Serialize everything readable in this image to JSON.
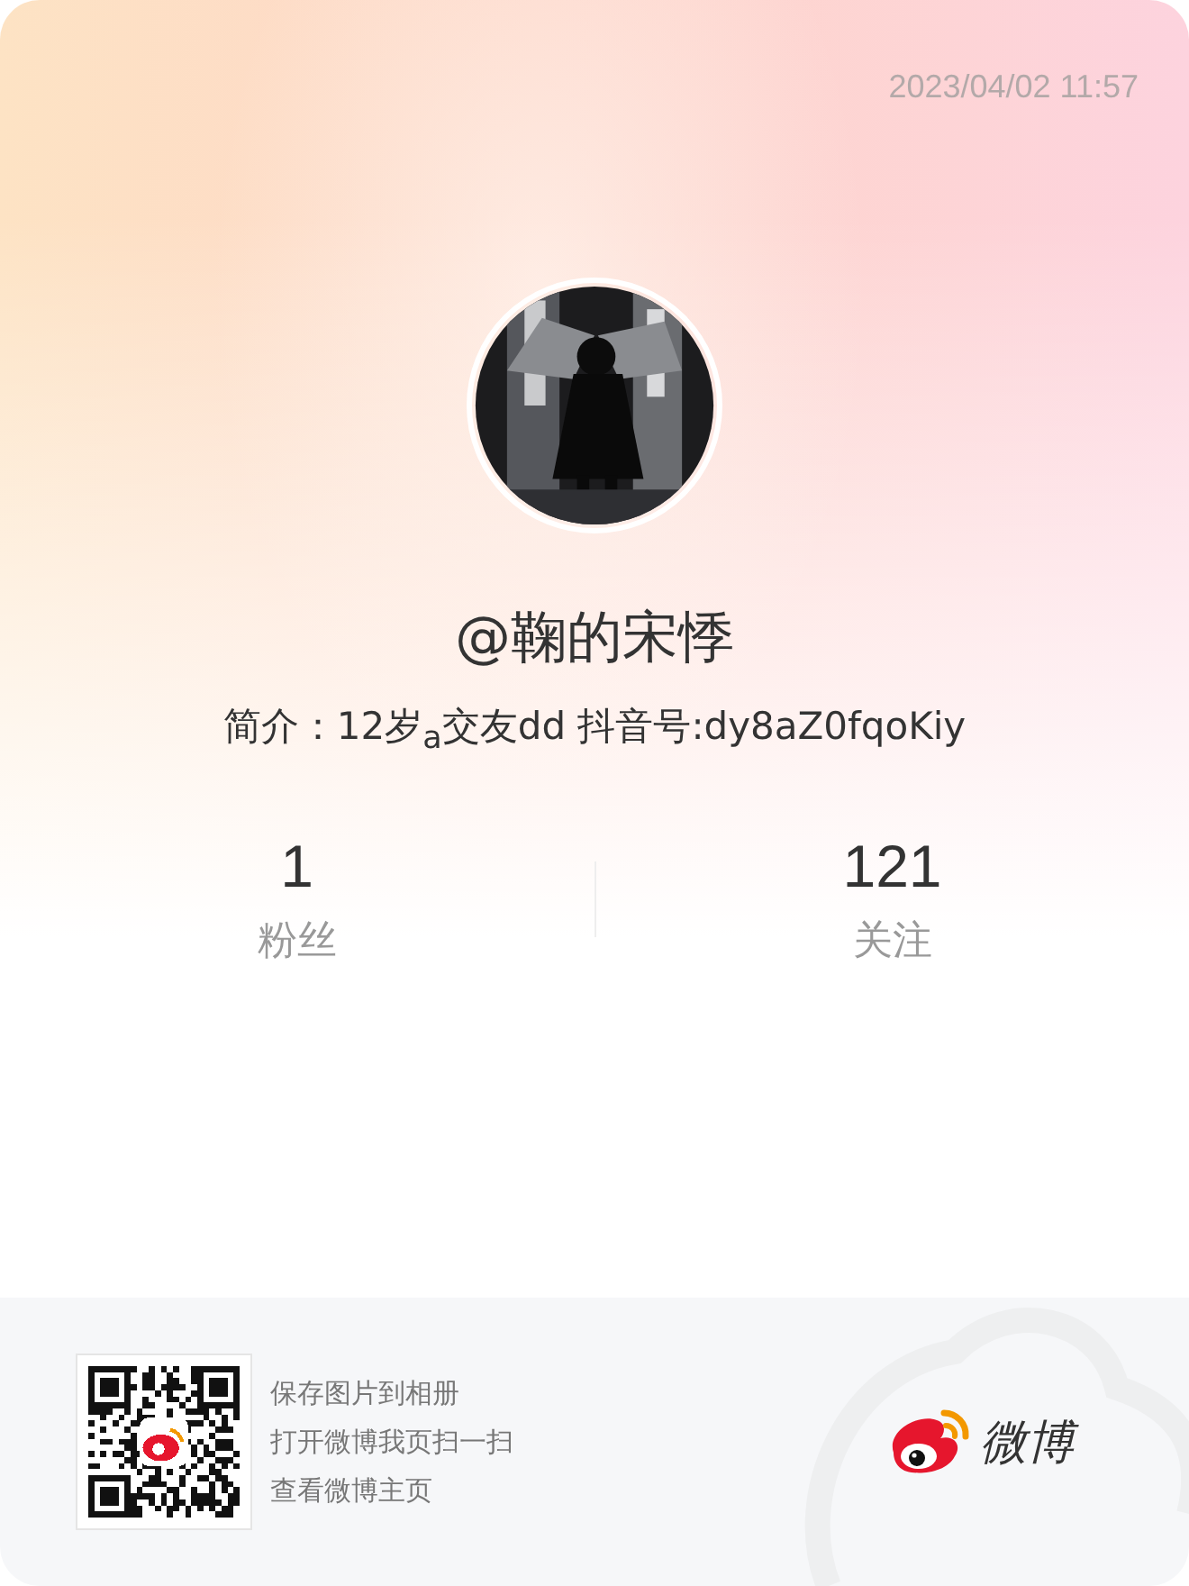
{
  "timestamp": "2023/04/02 11:57",
  "profile": {
    "name": "@鞠的宋悸",
    "bio": "简介：12岁$_{a}$交友dd 抖音号:dy8aZ0fqoKiy"
  },
  "stats": [
    {
      "value": "1",
      "label": "粉丝"
    },
    {
      "value": "121",
      "label": "关注"
    }
  ],
  "footer": {
    "lines": [
      "保存图片到相册",
      "打开微博我页扫一扫",
      "查看微博主页"
    ],
    "logo_text": "微博"
  }
}
